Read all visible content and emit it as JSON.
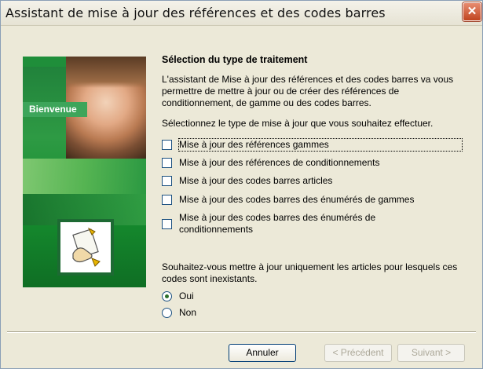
{
  "window": {
    "title": "Assistant de mise à jour des références et des codes barres",
    "close_glyph": "✕"
  },
  "sidebar": {
    "label": "Bienvenue",
    "icon": "hand-document-icon"
  },
  "main": {
    "heading": "Sélection du type de traitement",
    "intro": "L'assistant de Mise à jour des références et des codes barres va vous permettre de mettre à jour ou de créer des références de conditionnement, de gamme ou des codes barres.",
    "prompt": "Sélectionnez le type de mise à jour que vous souhaitez effectuer.",
    "options": [
      {
        "label": "Mise à jour des références gammes",
        "checked": false
      },
      {
        "label": "Mise à jour des références de conditionnements",
        "checked": false
      },
      {
        "label": "Mise à jour des codes barres articles",
        "checked": false
      },
      {
        "label": "Mise à jour des codes barres des énumérés de gammes",
        "checked": false
      },
      {
        "label": "Mise à jour des codes barres des énumérés de conditionnements",
        "checked": false
      }
    ],
    "question": "Souhaitez-vous mettre à jour uniquement les articles pour lesquels ces codes sont inexistants.",
    "radios": [
      {
        "label": "Oui",
        "selected": true
      },
      {
        "label": "Non",
        "selected": false
      }
    ]
  },
  "buttons": {
    "cancel": "Annuler",
    "prev": "< Précédent",
    "next": "Suivant >"
  }
}
